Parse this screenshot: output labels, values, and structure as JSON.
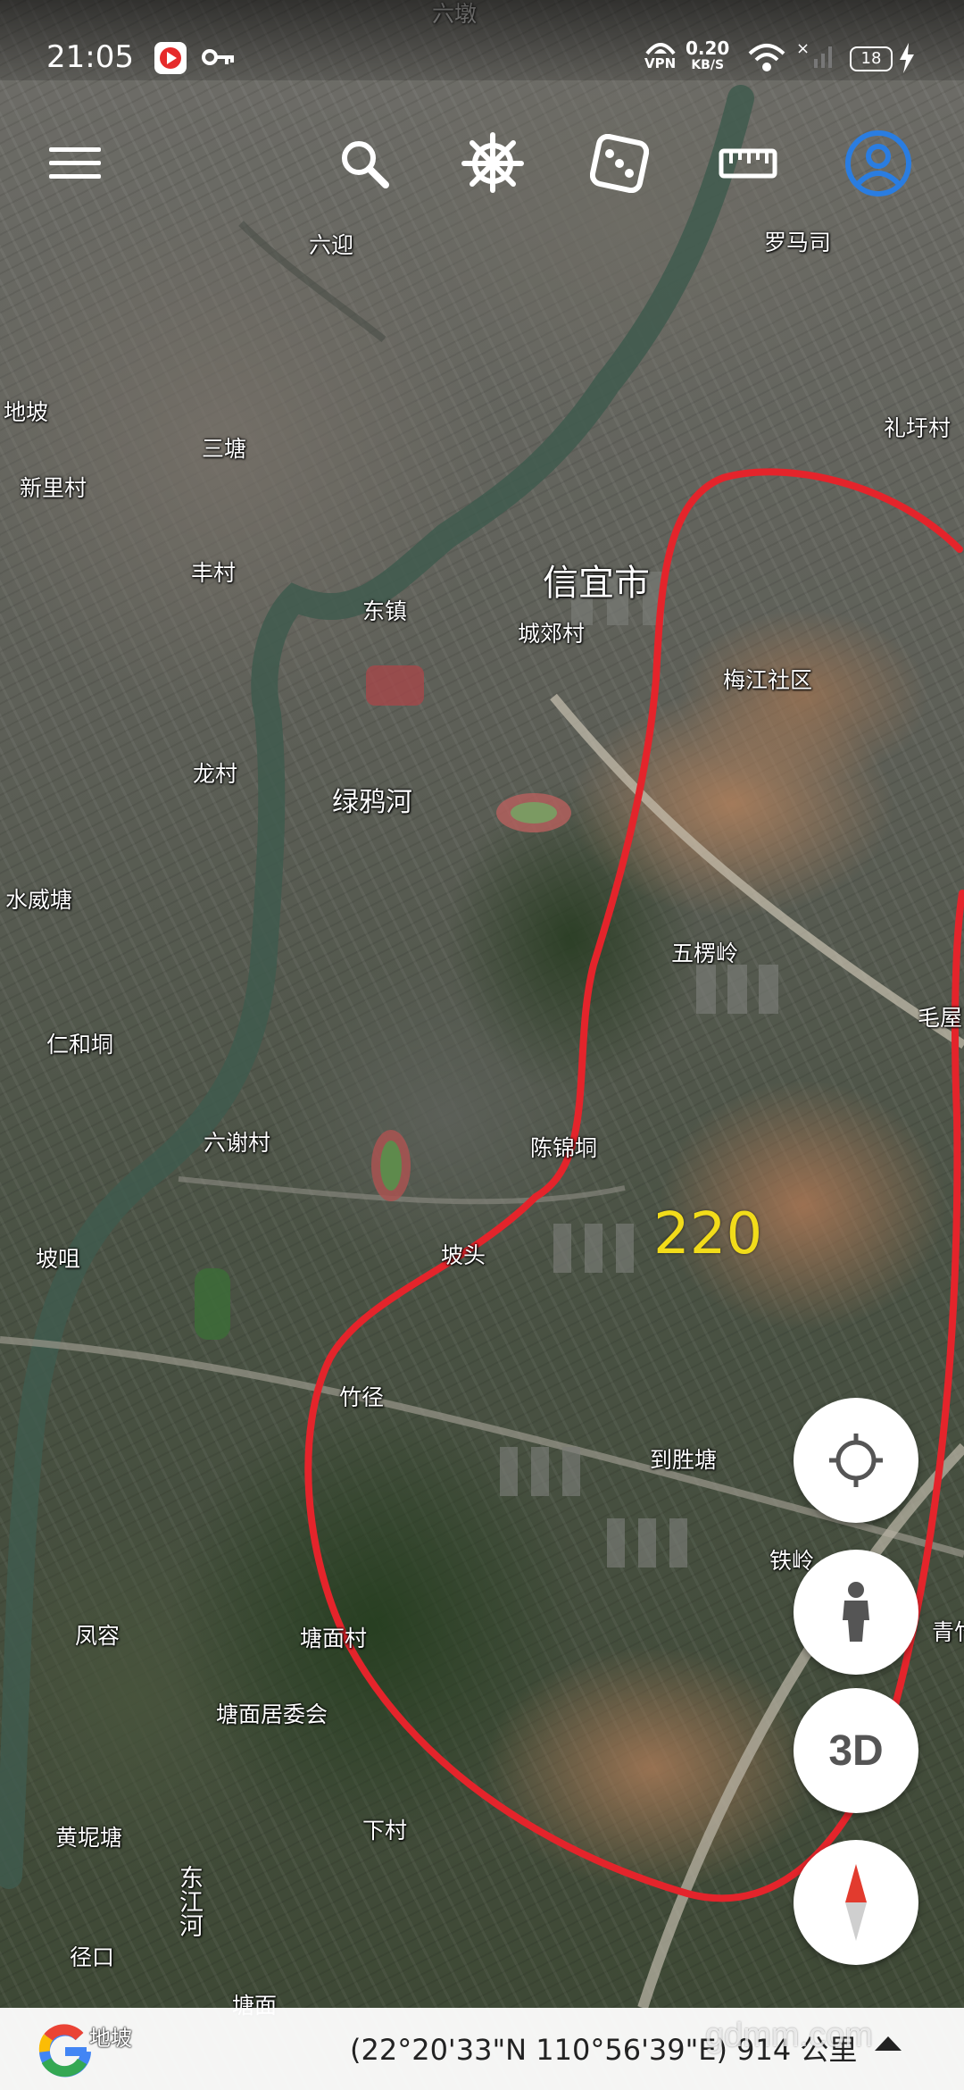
{
  "status_bar": {
    "time": "21:05",
    "vpn_label": "VPN",
    "net_speed": "0.20",
    "net_unit": "KB/S",
    "battery": "18",
    "icons": [
      "video-app-icon",
      "key-icon",
      "vpn-icon",
      "wifi-icon",
      "no-signal-icon",
      "battery-icon",
      "charging-icon"
    ]
  },
  "toolbar": {
    "icons": [
      "menu-icon",
      "search-icon",
      "voyager-wheel-icon",
      "dice-icon",
      "ruler-icon",
      "account-icon"
    ],
    "account_color": "#2a7de1"
  },
  "map": {
    "overlay_color": "#e4242b",
    "labels": [
      {
        "id": "liuying",
        "text": "六迎"
      },
      {
        "id": "luomasi",
        "text": "罗马司"
      },
      {
        "id": "dipo",
        "text": "地坡"
      },
      {
        "id": "santang",
        "text": "三塘"
      },
      {
        "id": "xinlicun",
        "text": "新里村"
      },
      {
        "id": "lixucun",
        "text": "礼圩村"
      },
      {
        "id": "fengcun",
        "text": "丰村"
      },
      {
        "id": "xinyishi",
        "text": "信宜市"
      },
      {
        "id": "dongzhen",
        "text": "东镇"
      },
      {
        "id": "chengjiaocun",
        "text": "城郊村"
      },
      {
        "id": "meijiang",
        "text": "梅江社区"
      },
      {
        "id": "longcun",
        "text": "龙村"
      },
      {
        "id": "lvyahe",
        "text": "绿鸦河"
      },
      {
        "id": "shuiweitang",
        "text": "水威塘"
      },
      {
        "id": "wulaoling",
        "text": "五楞岭"
      },
      {
        "id": "maowu",
        "text": "毛屋"
      },
      {
        "id": "renhedong",
        "text": "仁和垌"
      },
      {
        "id": "liuxiecun",
        "text": "六谢村"
      },
      {
        "id": "chenjindong",
        "text": "陈锦垌"
      },
      {
        "id": "pozu",
        "text": "坡咀"
      },
      {
        "id": "potou",
        "text": "坡头"
      },
      {
        "id": "zhujing",
        "text": "竹径"
      },
      {
        "id": "daoshengtang",
        "text": "到胜塘"
      },
      {
        "id": "tieling",
        "text": "铁岭"
      },
      {
        "id": "qingzhu",
        "text": "青竹"
      },
      {
        "id": "fengrong",
        "text": "凤容"
      },
      {
        "id": "tangmiancun",
        "text": "塘面村"
      },
      {
        "id": "tangmianjuweihui",
        "text": "塘面居委会"
      },
      {
        "id": "huangnitang",
        "text": "黄坭塘"
      },
      {
        "id": "xiacun",
        "text": "下村"
      },
      {
        "id": "dongjianghe",
        "text": "东江河"
      },
      {
        "id": "jingkou",
        "text": "径口"
      },
      {
        "id": "tangmian2",
        "text": "塘面"
      },
      {
        "id": "topcut",
        "text": "六墩"
      }
    ],
    "annotation": "220"
  },
  "fabs": {
    "locate_icon": "crosshair-icon",
    "streetview_icon": "pegman-icon",
    "label_3d": "3D",
    "compass_icon": "compass-icon"
  },
  "bottom_bar": {
    "layer_label": "地坡",
    "coordinates": "(22°20'33\"N 110°56'39\"E) 914 公里",
    "watermark": "gdmm.com"
  }
}
